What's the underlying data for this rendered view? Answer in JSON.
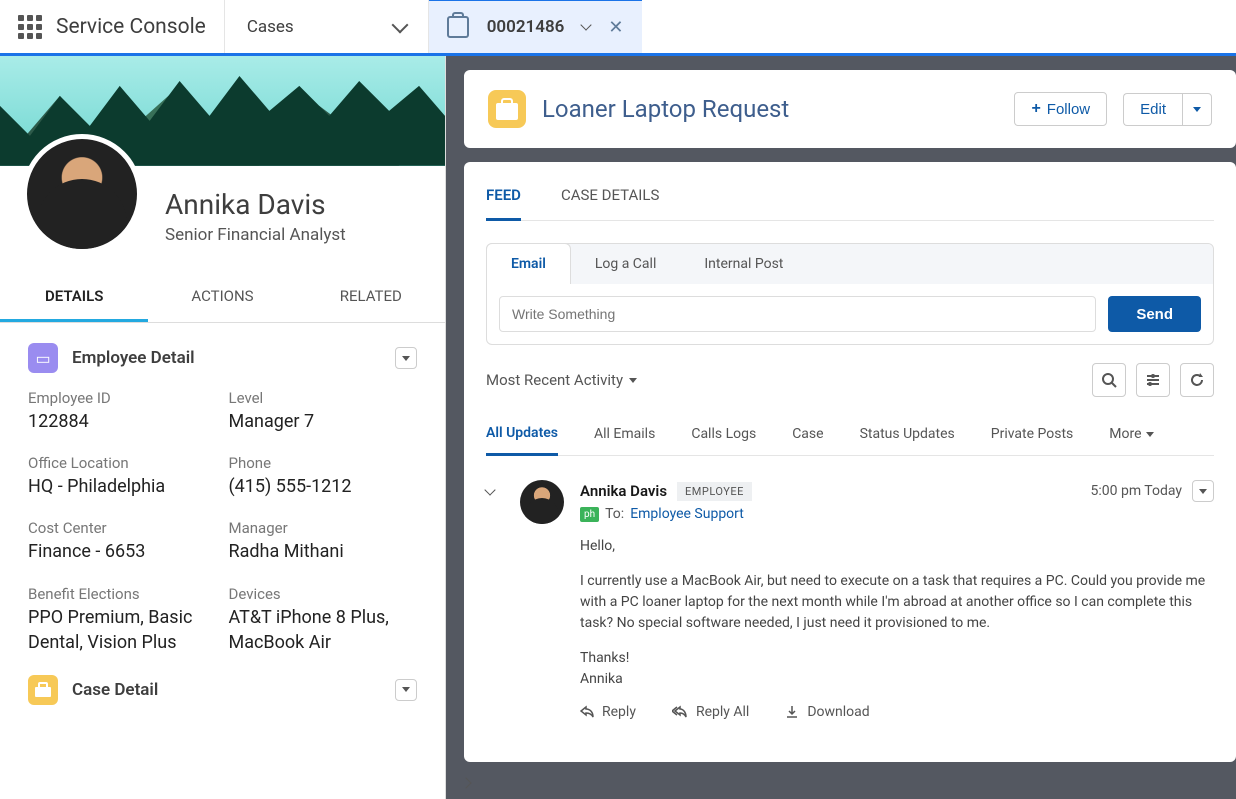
{
  "topbar": {
    "app_name": "Service Console",
    "nav_label": "Cases",
    "tab_label": "00021486"
  },
  "profile": {
    "name": "Annika Davis",
    "title": "Senior Financial Analyst",
    "tabs": [
      "DETAILS",
      "ACTIONS",
      "RELATED"
    ]
  },
  "employee_section": {
    "title": "Employee Detail",
    "fields": [
      {
        "label": "Employee ID",
        "value": "122884"
      },
      {
        "label": "Level",
        "value": "Manager 7"
      },
      {
        "label": "Office Location",
        "value": "HQ - Philadelphia"
      },
      {
        "label": "Phone",
        "value": "(415) 555-1212"
      },
      {
        "label": "Cost Center",
        "value": "Finance - 6653"
      },
      {
        "label": "Manager",
        "value": "Radha Mithani"
      },
      {
        "label": "Benefit Elections",
        "value": "PPO Premium, Basic Dental, Vision Plus"
      },
      {
        "label": "Devices",
        "value": "AT&T iPhone 8 Plus, MacBook Air"
      }
    ]
  },
  "case_section": {
    "title": "Case Detail"
  },
  "case_header": {
    "title": "Loaner Laptop Request",
    "follow_label": "Follow",
    "edit_label": "Edit"
  },
  "feed": {
    "tabs": [
      "FEED",
      "CASE DETAILS"
    ],
    "composer_tabs": [
      "Email",
      "Log a Call",
      "Internal Post"
    ],
    "composer_placeholder": "Write Something",
    "send_label": "Send",
    "sort_label": "Most Recent Activity",
    "filter_tabs": [
      "All Updates",
      "All Emails",
      "Calls Logs",
      "Case",
      "Status Updates",
      "Private Posts",
      "More"
    ]
  },
  "post": {
    "author": "Annika Davis",
    "badge": "EMPLOYEE",
    "time": "5:00 pm Today",
    "to_label": "To:",
    "to_recipient": "Employee Support",
    "greeting": "Hello,",
    "body": "I currently use a MacBook Air, but need to execute on a task that requires a PC.  Could you provide me with a PC loaner laptop for the next month while I'm abroad at another office so I can complete this task? No special software needed, I just need it provisioned to me.",
    "closing": "Thanks!",
    "signature": "Annika",
    "actions": {
      "reply": "Reply",
      "reply_all": "Reply All",
      "download": "Download"
    }
  }
}
